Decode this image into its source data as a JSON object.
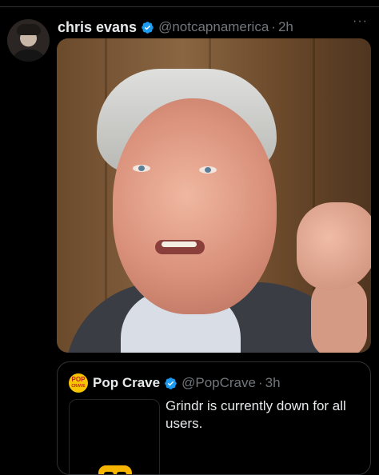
{
  "tweet": {
    "author_name": "chris evans",
    "handle": "@notcapnamerica",
    "separator": "·",
    "time": "2h",
    "more_label": "···",
    "verified_icon": "verified-badge-icon",
    "image_alt": "Photo of a man speaking with hand raised"
  },
  "quote": {
    "avatar_text_line1": "POP",
    "avatar_text_line2": "CRAVE",
    "author_name": "Pop Crave",
    "handle": "@PopCrave",
    "separator": "·",
    "time": "3h",
    "text": "Grindr is currently down for all users.",
    "media_icon": "grindr-mask-icon"
  },
  "colors": {
    "background": "#000000",
    "text": "#e7e9ea",
    "muted": "#71767b",
    "verified": "#1d9bf0",
    "border": "#2f3336",
    "grindr_yellow": "#f7b500",
    "popcrave_yellow": "#f7c600"
  }
}
